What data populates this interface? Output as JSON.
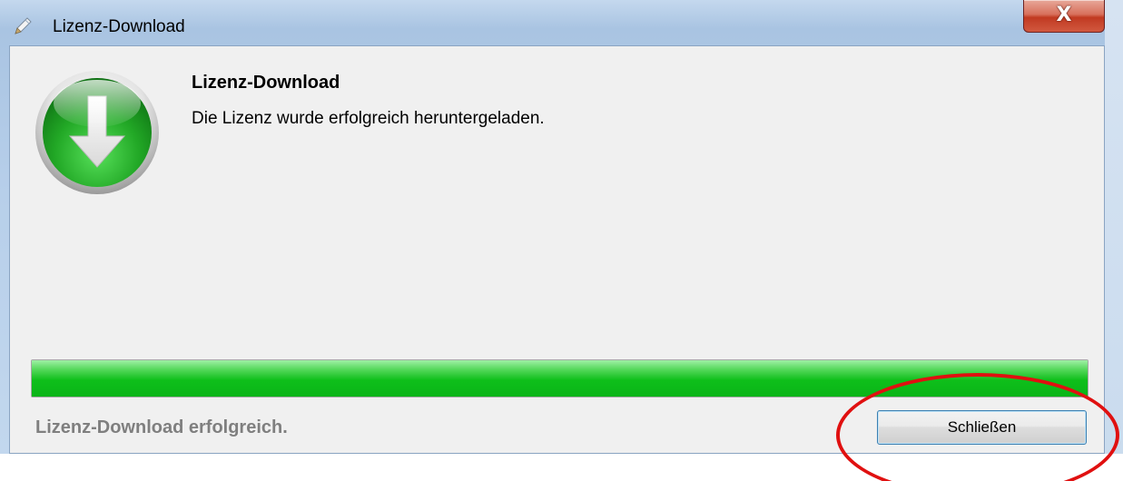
{
  "window": {
    "title": "Lizenz-Download",
    "close_glyph": "X"
  },
  "dialog": {
    "heading": "Lizenz-Download",
    "message": "Die Lizenz wurde erfolgreich heruntergeladen.",
    "icon": "download-arrow-icon"
  },
  "progress": {
    "value": 1.0
  },
  "status": {
    "text": "Lizenz-Download erfolgreich."
  },
  "buttons": {
    "close_label": "Schließen"
  },
  "colors": {
    "progress_green": "#0ebf1a",
    "icon_green": "#1f9e22",
    "annotation_red": "#e01010",
    "status_gray": "#7f7f7f"
  }
}
